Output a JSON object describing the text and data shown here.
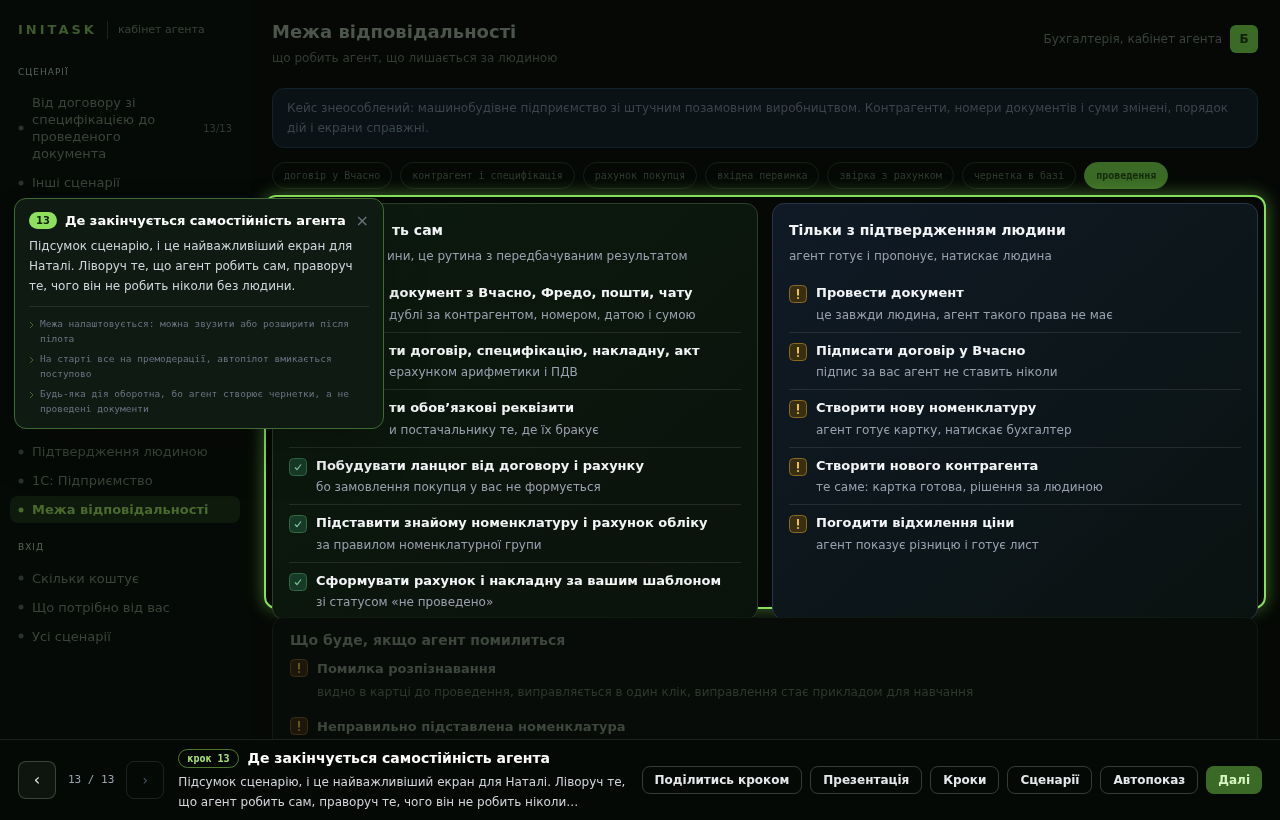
{
  "sidebar": {
    "brand": "INITASK",
    "subtitle": "кабінет агента",
    "sections": [
      {
        "title": "СЦЕНАРІЇ",
        "items": [
          {
            "label": "Від договору зі специфікацією до проведеного документа",
            "count": "13/13",
            "selected": false
          },
          {
            "label": "Інші сценарії",
            "selected": false
          }
        ]
      },
      {
        "items": [
          {
            "label": "Підтвердження людиною",
            "selected": false
          },
          {
            "label": "1С: Підприємство",
            "selected": false
          },
          {
            "label": "Межа відповідальності",
            "selected": true
          }
        ]
      },
      {
        "title": "ВХІД",
        "items": [
          {
            "label": "Скільки коштує",
            "selected": false
          },
          {
            "label": "Що потрібно від вас",
            "selected": false
          },
          {
            "label": "Усі сценарії",
            "selected": false
          }
        ]
      }
    ]
  },
  "header": {
    "title": "Межа відповідальності",
    "subtitle": "що робить агент, що лишається за людиною",
    "account": "Бухгалтерія, кабінет агента",
    "avatar": "Б"
  },
  "note": "Кейс знеособлений: машинобудівне підприємство зі штучним позамовним виробництвом. Контрагенти, номери документів і суми змінені, порядок дій і екрани справжні.",
  "chips": [
    {
      "label": "договір у Вчасно",
      "selected": false
    },
    {
      "label": "контрагент і специфікація",
      "selected": false
    },
    {
      "label": "рахунок покупця",
      "selected": false
    },
    {
      "label": "вхідна первинка",
      "selected": false
    },
    {
      "label": "звірка з рахунком",
      "selected": false
    },
    {
      "label": "чернетка в базі",
      "selected": false
    },
    {
      "label": "проведення",
      "selected": true
    }
  ],
  "columns": [
    {
      "kind": "self",
      "title": "ть сам",
      "subtitle": "ини, це рутина з передбачуваним результатом",
      "partial": true,
      "items": [
        {
          "title": "документ з Вчасно, Фредо, пошти, чату",
          "text": "дублі за контрагентом, номером, датою і сумою",
          "partial": true
        },
        {
          "title": "ти договір, специфікацію, накладну, акт",
          "text": "ерахунком арифметики і ПДВ",
          "partial": true
        },
        {
          "title": "ти обов’язкові реквізити",
          "text": "и постачальнику те, де їх бракує",
          "partial": true
        },
        {
          "title": "Побудувати ланцюг від договору і рахунку",
          "text": "бо замовлення покупця у вас не формується",
          "partial": false
        },
        {
          "title": "Підставити знайому номенклатуру і рахунок обліку",
          "text": "за правилом номенклатурної групи",
          "partial": false
        },
        {
          "title": "Сформувати рахунок і накладну за вашим шаблоном",
          "text": "зі статусом «не проведено»",
          "partial": false
        }
      ]
    },
    {
      "kind": "human",
      "title": "Тільки з підтвердженням людини",
      "subtitle": "агент готує і пропонує, натискає людина",
      "partial": false,
      "items": [
        {
          "title": "Провести документ",
          "text": "це завжди людина, агент такого права не має",
          "partial": false
        },
        {
          "title": "Підписати договір у Вчасно",
          "text": "підпис за вас агент не ставить ніколи",
          "partial": false
        },
        {
          "title": "Створити нову номенклатуру",
          "text": "агент готує картку, натискає бухгалтер",
          "partial": false
        },
        {
          "title": "Створити нового контрагента",
          "text": "те саме: картка готова, рішення за людиною",
          "partial": false
        },
        {
          "title": "Погодити відхилення ціни",
          "text": "агент показує різницю і готує лист",
          "partial": false
        }
      ]
    }
  ],
  "errors": {
    "title": "Що буде, якщо агент помилиться",
    "items": [
      {
        "title": "Помилка розпізнавання",
        "text": "видно в картці до проведення, виправляється в один клік, виправлення стає прикладом для навчання"
      },
      {
        "title": "Неправильно підставлена номенклатура"
      }
    ]
  },
  "popover": {
    "badge": "13",
    "title": "Де закінчується самостійність агента",
    "text": "Підсумок сценарію, і це найважливіший екран для Наталі. Ліворуч те, що агент робить сам, праворуч те, чого він не робить ніколи без людини.",
    "close": "×",
    "notes": [
      "Межа налаштовується: можна звузити або розширити після пілота",
      "На старті все на премодерації, автопілот вмикається поступово",
      "Будь-яка дія оборотна, бо агент створює чернетки, а не проведені документи"
    ]
  },
  "footer": {
    "prev": "‹",
    "counter": "13 / 13",
    "next": "›",
    "next_disabled": true,
    "badge": "крок 13",
    "title": "Де закінчується самостійність агента",
    "text": "Підсумок сценарію, і це найважливіший екран для Наталі. Ліворуч те, що агент робить сам, праворуч те, чого він не робить ніколи…",
    "buttons": [
      {
        "label": "Поділитись кроком",
        "primary": false
      },
      {
        "label": "Презентація",
        "primary": false
      },
      {
        "label": "Кроки",
        "primary": false
      },
      {
        "label": "Сценарії",
        "primary": false
      },
      {
        "label": "Автопоказ",
        "primary": false
      },
      {
        "label": "Далі",
        "primary": true
      }
    ]
  }
}
